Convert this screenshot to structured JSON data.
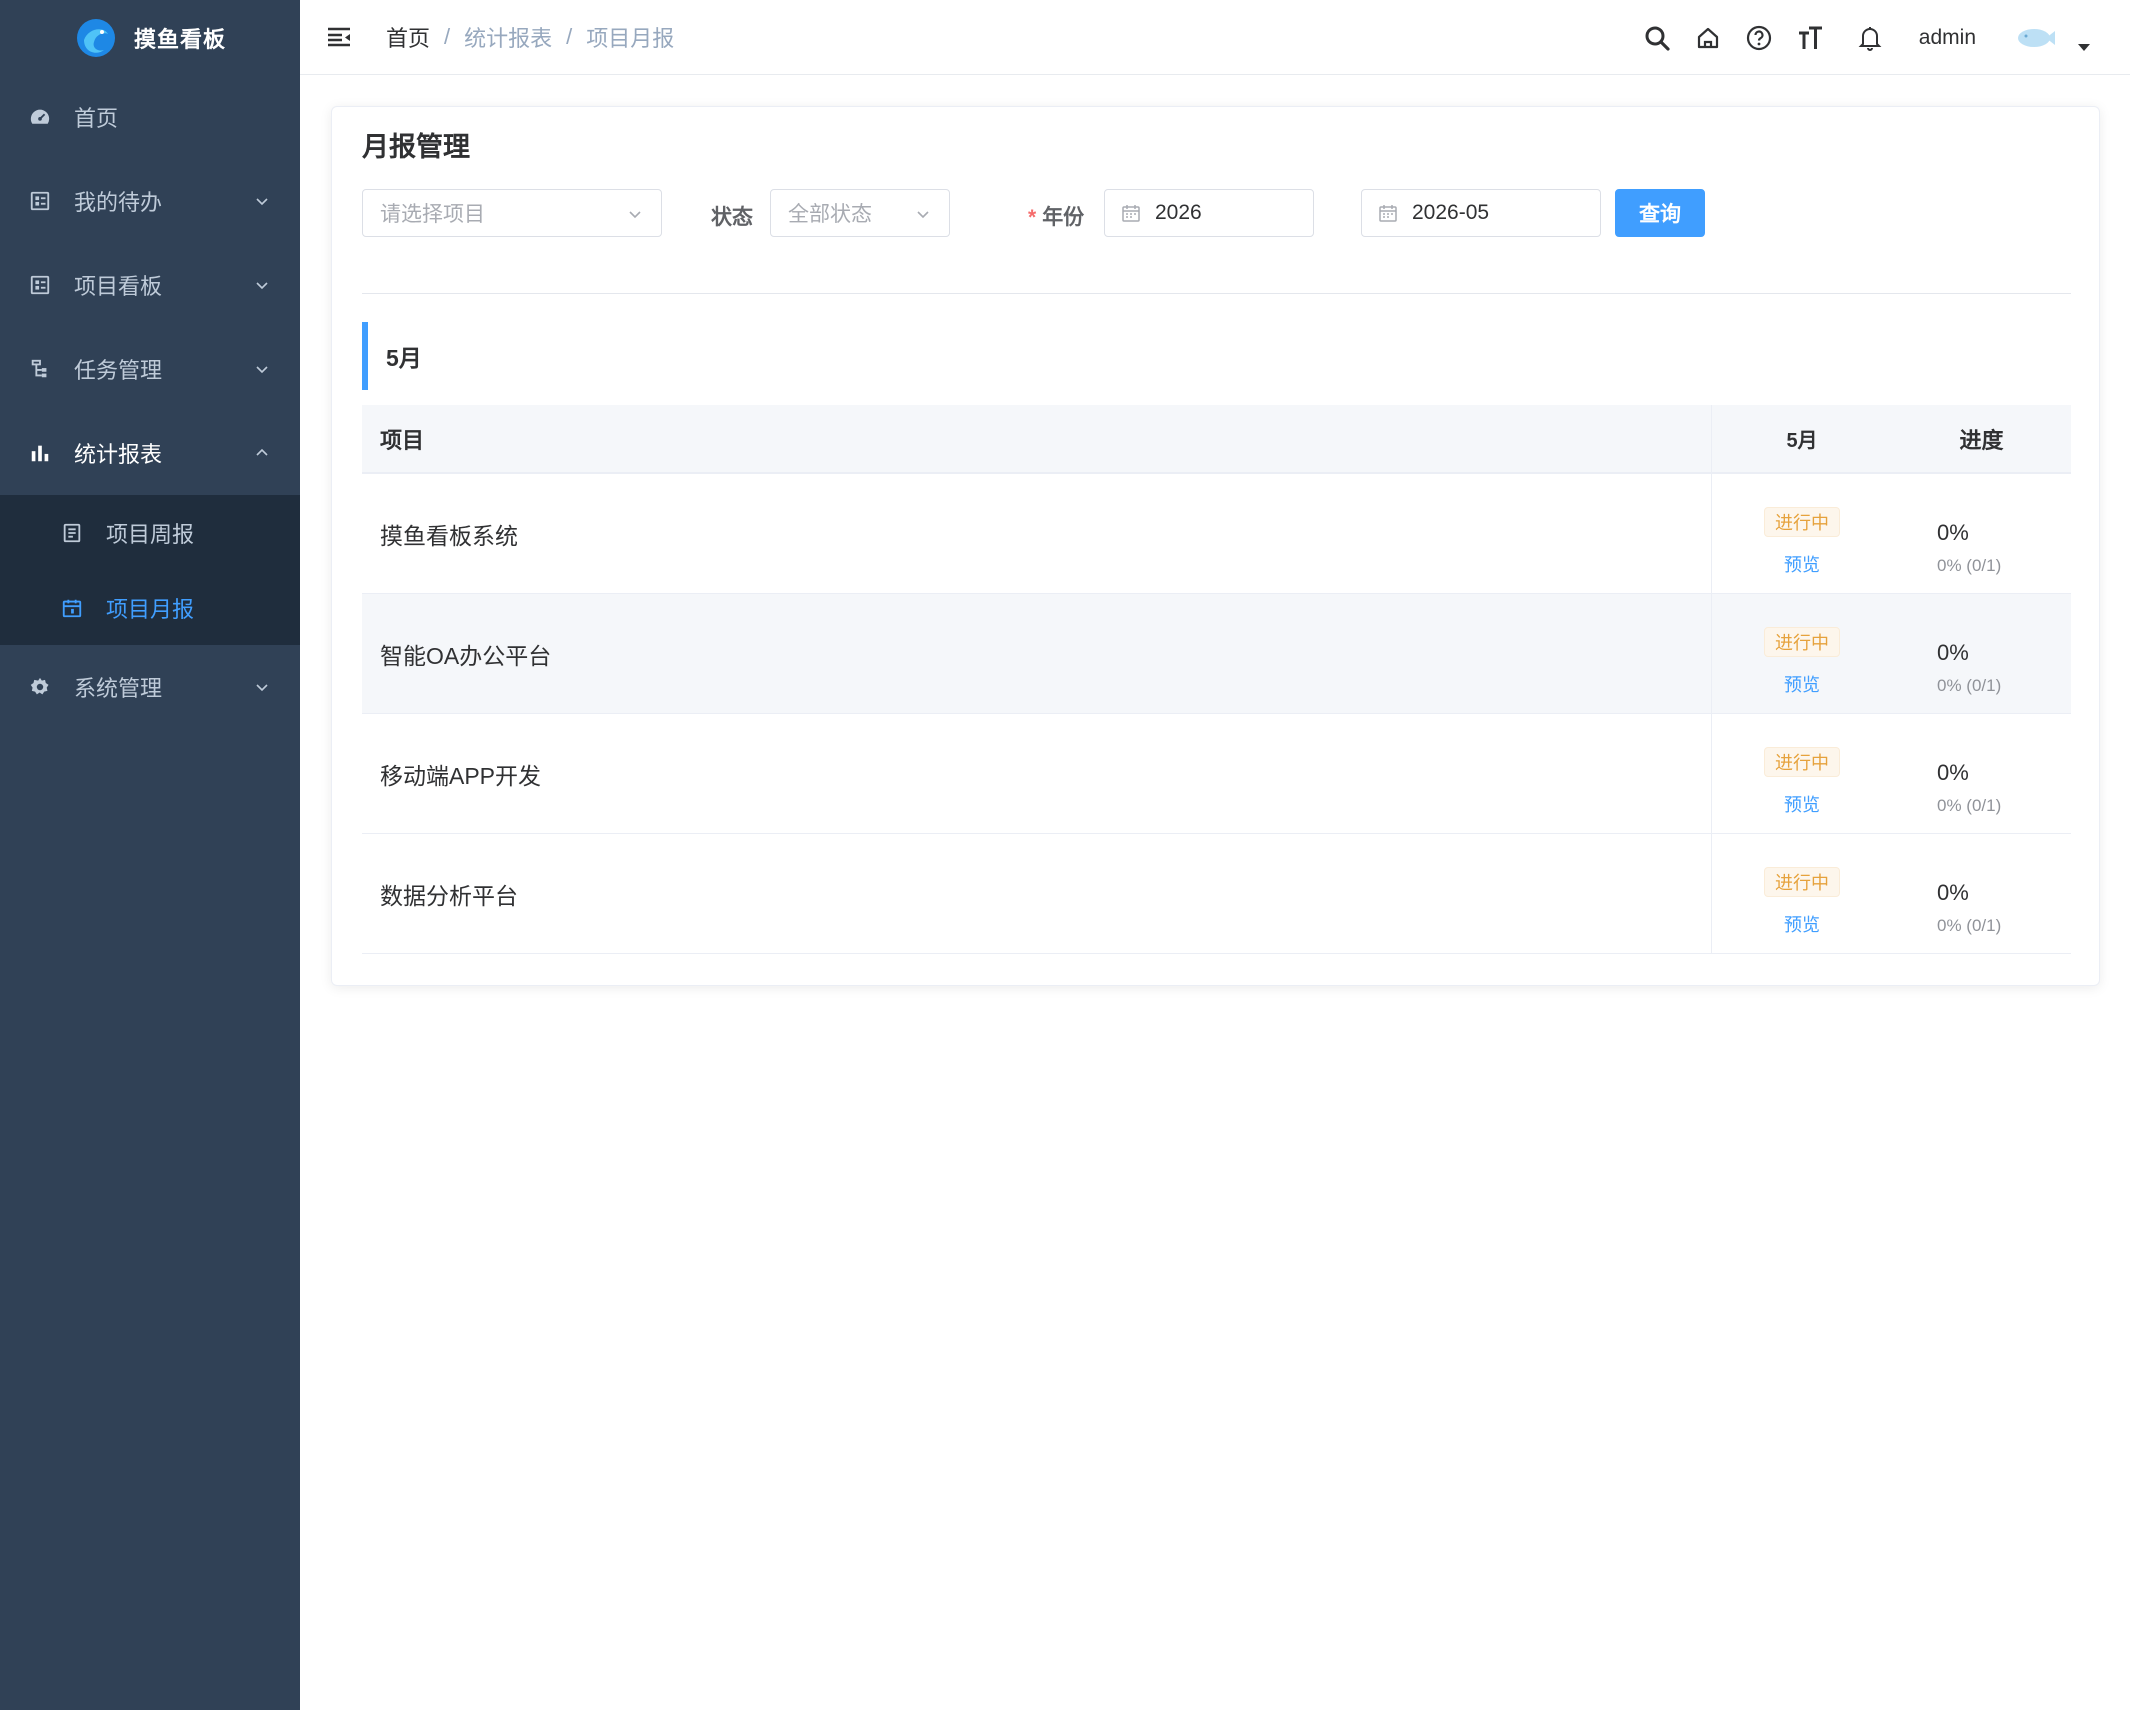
{
  "app": {
    "name": "摸鱼看板"
  },
  "sidebar": {
    "items": [
      {
        "label": "首页",
        "icon": "dashboard-icon"
      },
      {
        "label": "我的待办",
        "icon": "todo-list-icon"
      },
      {
        "label": "项目看板",
        "icon": "kanban-icon"
      },
      {
        "label": "任务管理",
        "icon": "tree-icon"
      },
      {
        "label": "统计报表",
        "icon": "bar-chart-icon",
        "expanded": true,
        "children": [
          {
            "label": "项目周报",
            "icon": "document-icon"
          },
          {
            "label": "项目月报",
            "icon": "calendar-icon",
            "active": true
          }
        ]
      },
      {
        "label": "系统管理",
        "icon": "gear-icon"
      }
    ]
  },
  "header": {
    "breadcrumb": [
      "首页",
      "统计报表",
      "项目月报"
    ],
    "separator": "/",
    "username": "admin",
    "tools": [
      "search-icon",
      "home-icon",
      "help-icon",
      "font-size-icon",
      "bell-icon"
    ]
  },
  "page": {
    "title": "月报管理",
    "filters": {
      "project_placeholder": "请选择项目",
      "status_label": "状态",
      "status_placeholder": "全部状态",
      "year_required_mark": "*",
      "year_label": "年份",
      "year_value": "2026",
      "month_value": "2026-05",
      "query_button": "查询"
    },
    "section_title": "5月",
    "table": {
      "columns": [
        "项目",
        "5月",
        "进度"
      ],
      "rows": [
        {
          "name": "摸鱼看板系统",
          "status": "进行中",
          "action": "预览",
          "progress": "0%",
          "detail": "0% (0/1)"
        },
        {
          "name": "智能OA办公平台",
          "status": "进行中",
          "action": "预览",
          "progress": "0%",
          "detail": "0% (0/1)"
        },
        {
          "name": "移动端APP开发",
          "status": "进行中",
          "action": "预览",
          "progress": "0%",
          "detail": "0% (0/1)"
        },
        {
          "name": "数据分析平台",
          "status": "进行中",
          "action": "预览",
          "progress": "0%",
          "detail": "0% (0/1)"
        }
      ]
    }
  },
  "colors": {
    "sidebar_bg": "#304156",
    "submenu_bg": "#1f2d3d",
    "accent": "#409eff",
    "warning": "#e6a23c"
  }
}
